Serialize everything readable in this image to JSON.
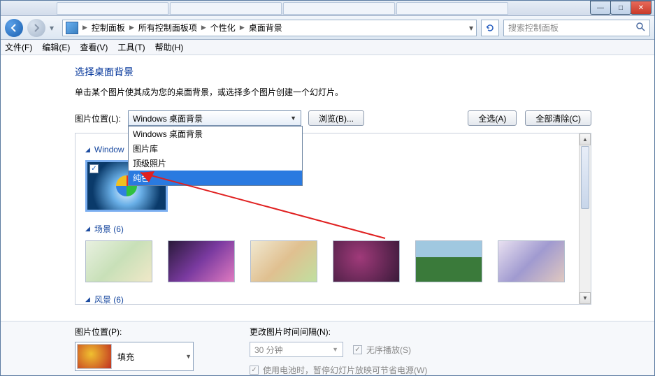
{
  "window": {
    "minimize": "—",
    "maximize": "□",
    "close": "✕"
  },
  "breadcrumb": {
    "items": [
      "控制面板",
      "所有控制面板项",
      "个性化",
      "桌面背景"
    ]
  },
  "search": {
    "placeholder": "搜索控制面板"
  },
  "menu": {
    "file": "文件(F)",
    "edit": "编辑(E)",
    "view": "查看(V)",
    "tools": "工具(T)",
    "help": "帮助(H)"
  },
  "page": {
    "title": "选择桌面背景",
    "desc": "单击某个图片使其成为您的桌面背景，或选择多个图片创建一个幻灯片。"
  },
  "picloc": {
    "label": "图片位置(L):",
    "value": "Windows 桌面背景",
    "options": [
      "Windows 桌面背景",
      "图片库",
      "顶级照片",
      "纯色"
    ],
    "browse": "浏览(B)...",
    "select_all": "全选(A)",
    "clear_all": "全部清除(C)"
  },
  "groups": {
    "g1": "Windows (1)",
    "g1_short": "Window",
    "g2": "场景 (6)",
    "g3": "风景 (6)"
  },
  "bottom": {
    "pos_label": "图片位置(P):",
    "pos_value": "填充",
    "interval_label": "更改图片时间间隔(N):",
    "interval_value": "30 分钟",
    "shuffle": "无序播放(S)",
    "battery": "使用电池时，暂停幻灯片放映可节省电源(W)"
  }
}
